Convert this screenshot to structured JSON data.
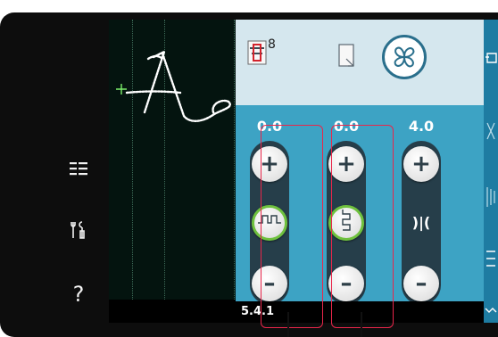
{
  "sidebar": {
    "icons": [
      "list-icon",
      "tools-icon",
      "help-icon"
    ],
    "help_label": "?"
  },
  "toolbar": {
    "presser_foot_badge": "8"
  },
  "controls": [
    {
      "value": "0.0",
      "plus": "+",
      "minus": "–",
      "center_icon": "stitch-width-icon"
    },
    {
      "value": "0.0",
      "plus": "+",
      "minus": "–",
      "center_icon": "stitch-position-icon"
    },
    {
      "value": "4.0",
      "plus": "+",
      "minus": "–",
      "center_icon": "stitch-density-icon",
      "center_glyph": ")|("
    }
  ],
  "status": {
    "code": "5.4.1"
  },
  "colors": {
    "panel": "#3da3c4",
    "toolbar": "#d5e7ee",
    "pill": "#263e4a",
    "ring": "#6fc13e",
    "highlight": "#e9264b"
  }
}
